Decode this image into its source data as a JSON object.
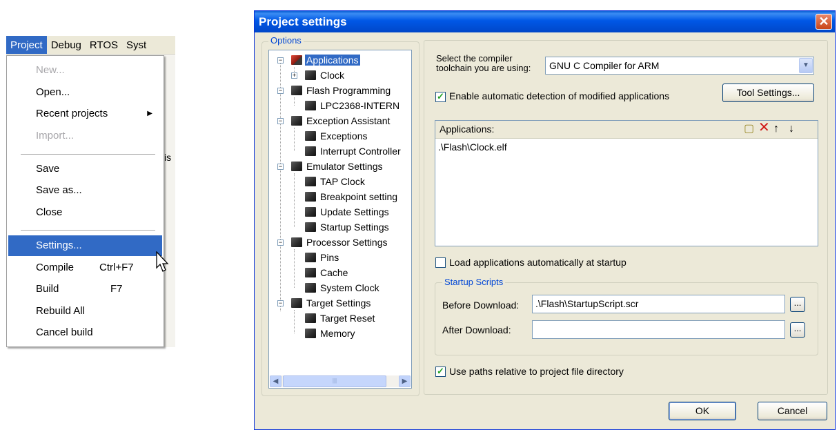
{
  "menubar": {
    "items": [
      "Project",
      "Debug",
      "RTOS",
      "Syst"
    ],
    "active_index": 0
  },
  "project_menu": {
    "items": [
      {
        "label": "New...",
        "shortcut": "",
        "disabled": true
      },
      {
        "label": "Open...",
        "shortcut": "",
        "disabled": false
      },
      {
        "label": "Recent projects",
        "shortcut": "",
        "disabled": false,
        "submenu": true
      },
      {
        "label": "Import...",
        "shortcut": "",
        "disabled": true
      },
      {
        "label": "Save",
        "shortcut": "",
        "disabled": false
      },
      {
        "label": "Save as...",
        "shortcut": "",
        "disabled": false
      },
      {
        "label": "Close",
        "shortcut": "",
        "disabled": false
      },
      {
        "label": "Settings...",
        "shortcut": "",
        "disabled": false,
        "highlighted": true
      },
      {
        "label": "Compile",
        "shortcut": "Ctrl+F7",
        "disabled": false
      },
      {
        "label": "Build",
        "shortcut": "F7",
        "disabled": false
      },
      {
        "label": "Rebuild All",
        "shortcut": "",
        "disabled": false
      },
      {
        "label": "Cancel build",
        "shortcut": "",
        "disabled": false
      }
    ],
    "background_fragment": "is"
  },
  "dialog": {
    "title": "Project settings",
    "close_glyph": "✕",
    "options_legend": "Options",
    "tree": [
      {
        "label": "Applications",
        "selected": true
      },
      {
        "label": "Clock"
      },
      {
        "label": "Flash Programming"
      },
      {
        "label": "LPC2368-INTERN"
      },
      {
        "label": "Exception Assistant"
      },
      {
        "label": "Exceptions"
      },
      {
        "label": "Interrupt Controller"
      },
      {
        "label": "Emulator Settings"
      },
      {
        "label": "TAP Clock"
      },
      {
        "label": "Breakpoint setting"
      },
      {
        "label": "Update Settings"
      },
      {
        "label": "Startup Settings"
      },
      {
        "label": "Processor Settings"
      },
      {
        "label": "Pins"
      },
      {
        "label": "Cache"
      },
      {
        "label": "System Clock"
      },
      {
        "label": "Target Settings"
      },
      {
        "label": "Target Reset"
      },
      {
        "label": "Memory"
      }
    ],
    "compiler_label_line1": "Select the compiler",
    "compiler_label_line2": "toolchain you are using:",
    "compiler_value": "GNU C Compiler for ARM",
    "auto_detect_label": "Enable automatic detection of modified applications",
    "auto_detect_checked": true,
    "tool_settings_button": "Tool Settings...",
    "applications_header": "Applications:",
    "applications": [
      ".\\Flash\\Clock.elf"
    ],
    "load_auto_label": "Load applications automatically at startup",
    "load_auto_checked": false,
    "startup_scripts_legend": "Startup Scripts",
    "before_download_label": "Before Download:",
    "before_download_value": ".\\Flash\\StartupScript.scr",
    "after_download_label": "After Download:",
    "after_download_value": "",
    "browse_label": "...",
    "relative_paths_label": "Use paths relative to project file directory",
    "relative_paths_checked": true,
    "ok_button": "OK",
    "cancel_button": "Cancel"
  }
}
